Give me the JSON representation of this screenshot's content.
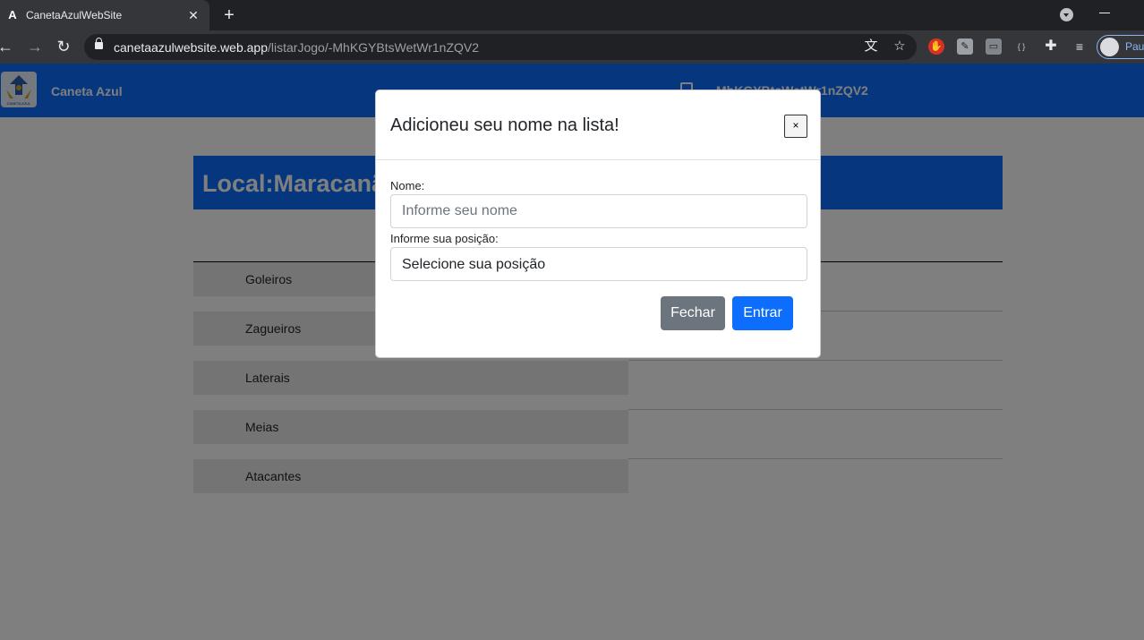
{
  "browser": {
    "tab_title": "CanetaAzulWebSite",
    "tab_favicon": "A",
    "tab_close": "✕",
    "new_tab": "+",
    "url_host": "canetaazulwebsite.web.app",
    "url_path": "/listarJogo/-MhKGYBtsWetWr1nZQV2",
    "profile_label": "Paus"
  },
  "navbar": {
    "brand": "Caneta Azul",
    "logo_text": "CANETA AZUL",
    "game_id": "MhKGYBtsWetWr1nZQV2"
  },
  "main": {
    "local_title": "Local:Maracanã",
    "positions": [
      {
        "label": "Goleiros"
      },
      {
        "label": "Zagueiros"
      },
      {
        "label": "Laterais"
      },
      {
        "label": "Meias"
      },
      {
        "label": "Atacantes"
      }
    ]
  },
  "modal": {
    "title": "Adicioneu seu nome na lista!",
    "close_label": "×",
    "name_label": "Nome:",
    "name_placeholder": "Informe seu nome",
    "name_value": "",
    "position_label": "Informe sua posição:",
    "position_selected": "Selecione sua posição",
    "close_button": "Fechar",
    "submit_button": "Entrar"
  },
  "icons": {
    "back": "arrow-left-icon",
    "forward": "arrow-right-icon",
    "reload": "reload-icon",
    "lock": "lock-icon",
    "translate": "translate-icon",
    "bookmark": "star-icon",
    "extensions": "puzzle-icon",
    "media": "media-control-icon",
    "game_id": "copy-icon"
  },
  "colors": {
    "primary": "#0d6efd",
    "secondary": "#6c757d",
    "chrome_dark": "#202124",
    "chrome_toolbar": "#35363a"
  }
}
